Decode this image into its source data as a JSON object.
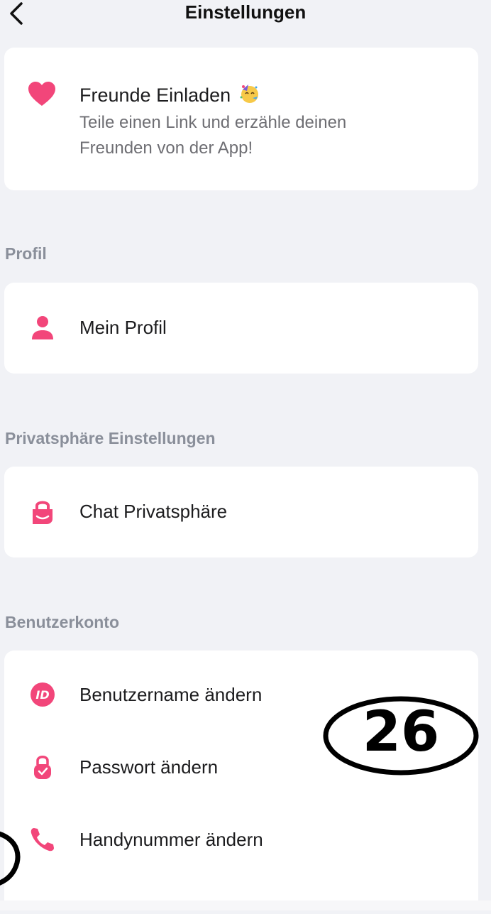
{
  "header": {
    "title": "Einstellungen",
    "back_icon": "chevron-left-icon"
  },
  "invite": {
    "title": "Freunde Einladen",
    "subtitle": "Teile einen Link und erzähle deinen Freunden von der App!",
    "icon": "heart-icon",
    "emoji_icon": "party-face-emoji-icon"
  },
  "sections": {
    "profile": {
      "label": "Profil",
      "items": [
        {
          "label": "Mein Profil",
          "icon": "person-icon"
        }
      ]
    },
    "privacy": {
      "label": "Privatsphäre Einstellungen",
      "items": [
        {
          "label": "Chat Privatsphäre",
          "icon": "chat-lock-icon"
        }
      ]
    },
    "account": {
      "label": "Benutzerkonto",
      "items": [
        {
          "label": "Benutzername ändern",
          "icon": "id-badge-icon"
        },
        {
          "label": "Passwort ändern",
          "icon": "lock-check-icon"
        },
        {
          "label": "Handynummer ändern",
          "icon": "phone-icon"
        }
      ]
    }
  },
  "annotation": {
    "number": "26"
  },
  "colors": {
    "accent": "#f2467a",
    "background": "#f1f2f6",
    "card": "#ffffff",
    "section_label": "#8a8f9a"
  }
}
